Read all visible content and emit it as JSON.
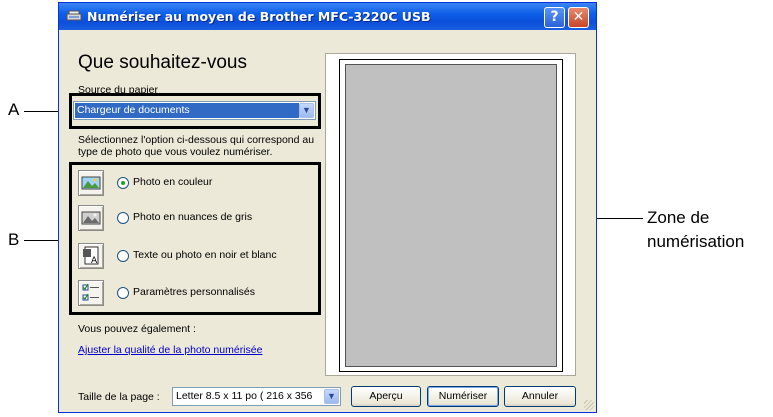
{
  "window": {
    "title": "Numériser au moyen de Brother MFC-3220C USB",
    "help_icon": "?",
    "close_icon": "✕"
  },
  "panel": {
    "heading": "Que souhaitez-vous",
    "source_label": "Source du papier",
    "source_value": "Chargeur de documents",
    "instructions": "Sélectionnez l'option ci-dessous qui correspond au type de photo que vous voulez numériser.",
    "scan_types": [
      {
        "label": "Photo en couleur",
        "icon": "color-photo-icon",
        "checked": true
      },
      {
        "label": "Photo en nuances de gris",
        "icon": "grayscale-photo-icon",
        "checked": false
      },
      {
        "label": "Texte ou photo en noir et blanc",
        "icon": "black-white-text-icon",
        "checked": false
      },
      {
        "label": "Paramètres personnalisés",
        "icon": "custom-settings-icon",
        "checked": false
      }
    ],
    "also_label": "Vous pouvez également :",
    "adjust_link": "Ajuster la qualité de la photo numérisée"
  },
  "footer": {
    "page_size_label": "Taille de la page :",
    "page_size_value": "Letter 8.5 x 11 po ( 216 x 356",
    "preview_button": "Aperçu",
    "scan_button": "Numériser",
    "cancel_button": "Annuler"
  },
  "callouts": {
    "a": "A",
    "b": "B",
    "zone_line1": "Zone de",
    "zone_line2": "numérisation"
  },
  "colors": {
    "title_bar": "#0b4fdb",
    "selection": "#316ac5",
    "link": "#0000cc",
    "radio_dot": "#21a121"
  }
}
